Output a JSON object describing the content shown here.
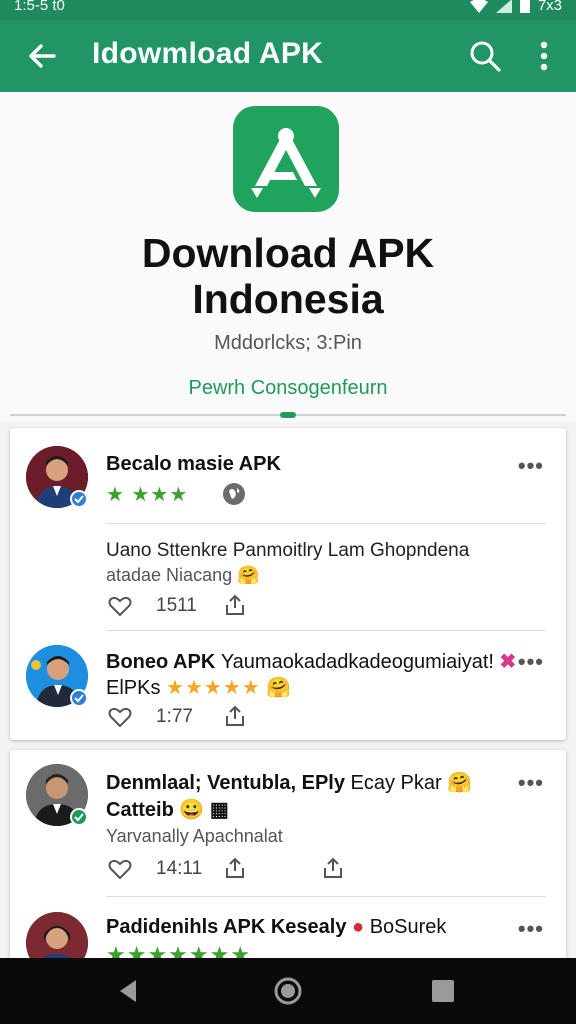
{
  "status": {
    "time": "1:5-5  t0",
    "right_text": "7x3"
  },
  "app_bar": {
    "title": "Idowmload APK",
    "back_icon": "arrow-left-icon",
    "search_icon": "search-icon",
    "more_icon": "more-vert-icon"
  },
  "hero": {
    "app_icon": "app-logo-icon",
    "title_line1": "Download APK",
    "title_line2": "Indonesia",
    "meta": "Mddorlcks; 3:Pin",
    "link": "Pewrh Consogenfeurn"
  },
  "posts": [
    {
      "author": "Becalo masie APK",
      "rating": "★ ★★★",
      "badge_icon": "globe-icon",
      "text": "Uano Sttenkre Panmoitlry Lam Ghopndena",
      "subtext": "atadae Niacang",
      "emoji": "🤗",
      "likes": "1511",
      "dots": "•••"
    },
    {
      "author": "Boneo APK",
      "author_rest": "Yaumaokadadkadeogumiaiyat!",
      "line2": "ElPKs",
      "stars": "★★★★★",
      "emoji": "🤗",
      "likes": "1:77",
      "dots": "•••"
    },
    {
      "author": "Denmlaal; Ventubla, EPly",
      "author_rest": "Ecay Pkar",
      "line2": "Catteib",
      "emoji": "🤗",
      "emoji2": "😀",
      "text": "Yarvanally Apachnalat",
      "likes": "14:11",
      "dots": "•••"
    },
    {
      "author": "Padidenihls APK Kesealy",
      "author_rest": "BoSurek",
      "stars": "★★★★★★★",
      "dots": "•••"
    }
  ],
  "colors": {
    "primary": "#219566",
    "accent": "#1f9a5a",
    "star": "#f5a623",
    "green_star": "#3aa12a",
    "verified": "#2f7fd6"
  }
}
